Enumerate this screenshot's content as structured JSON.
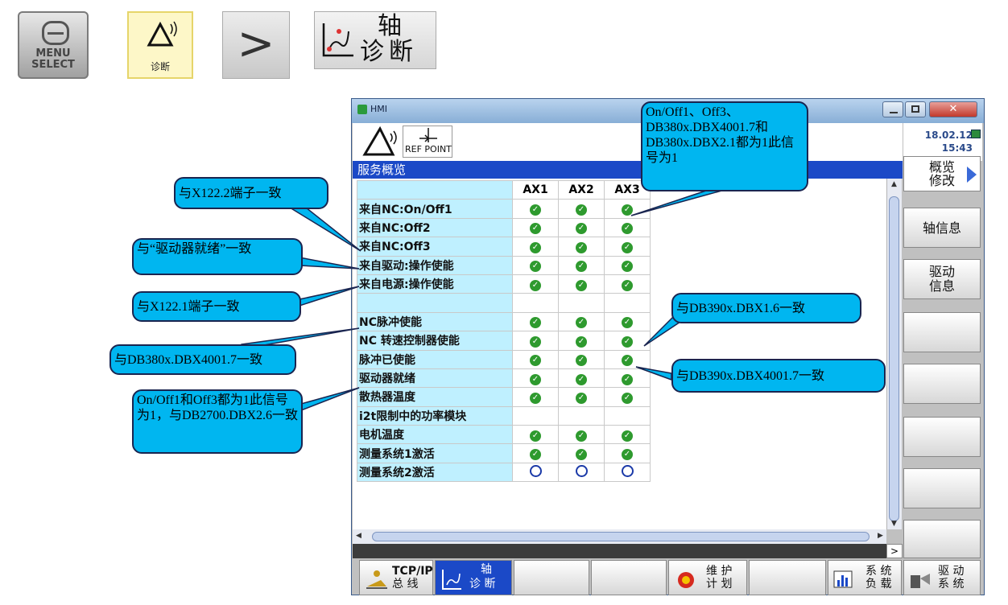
{
  "keys": {
    "menu_select_line1": "MENU",
    "menu_select_line2": "SELECT",
    "diagnosis_label": "诊断",
    "next_label": ">",
    "axis_diag_line1": "轴",
    "axis_diag_line2": "诊断"
  },
  "window": {
    "title": "HMI",
    "ref_point": "REF POINT",
    "date": "18.02.12",
    "time": "15:43",
    "panel_title": "服务概览"
  },
  "table": {
    "columns": [
      "AX1",
      "AX2",
      "AX3"
    ],
    "rows": [
      {
        "label": "来自NC:On/Off1",
        "status": [
          "ok",
          "ok",
          "ok"
        ]
      },
      {
        "label": "来自NC:Off2",
        "status": [
          "ok",
          "ok",
          "ok"
        ]
      },
      {
        "label": "来自NC:Off3",
        "status": [
          "ok",
          "ok",
          "ok"
        ]
      },
      {
        "label": "来自驱动:操作使能",
        "status": [
          "ok",
          "ok",
          "ok"
        ]
      },
      {
        "label": "来自电源:操作使能",
        "status": [
          "ok",
          "ok",
          "ok"
        ]
      },
      {
        "label": "",
        "status": [
          "",
          "",
          ""
        ]
      },
      {
        "label": "NC脉冲使能",
        "status": [
          "ok",
          "ok",
          "ok"
        ]
      },
      {
        "label": "NC 转速控制器使能",
        "status": [
          "ok",
          "ok",
          "ok"
        ]
      },
      {
        "label": "脉冲已使能",
        "status": [
          "ok",
          "ok",
          "ok"
        ]
      },
      {
        "label": "驱动器就绪",
        "status": [
          "ok",
          "ok",
          "ok"
        ]
      },
      {
        "label": "散热器温度",
        "status": [
          "ok",
          "ok",
          "ok"
        ]
      },
      {
        "label": "i2t限制中的功率模块",
        "status": [
          "",
          "",
          ""
        ]
      },
      {
        "label": "电机温度",
        "status": [
          "ok",
          "ok",
          "ok"
        ]
      },
      {
        "label": "测量系统1激活",
        "status": [
          "ok",
          "ok",
          "ok"
        ]
      },
      {
        "label": "测量系统2激活",
        "status": [
          "off",
          "off",
          "off"
        ]
      }
    ]
  },
  "vsoftkeys": {
    "overview_modify_1": "概览",
    "overview_modify_2": "修改",
    "axis_info": "轴信息",
    "drive_info_1": "驱动",
    "drive_info_2": "信息"
  },
  "hsoftkeys": {
    "tcpip_1": "TCP/IP",
    "tcpip_2": "总 线",
    "axis_1": "轴",
    "axis_2": "诊 断",
    "maint_1": "维 护",
    "maint_2": "计 划",
    "sys_1": "系 统",
    "sys_2": "负 载",
    "drv_1": "驱 动",
    "drv_2": "系 统"
  },
  "callouts": {
    "c1": "与X122.2端子一致",
    "c2": "与“驱动器就绪”一致",
    "c3": "与X122.1端子一致",
    "c4": "与DB380x.DBX4001.7一致",
    "c5": "On/Off1和Off3都为1此信号为1，与DB2700.DBX2.6一致",
    "c6": "On/Off1、Off3、DB380x.DBX4001.7和DB380x.DBX2.1都为1此信号为1",
    "c7": "与DB390x.DBX1.6一致",
    "c8": "与DB390x.DBX4001.7一致"
  },
  "colors": {
    "panel_blue": "#1b49c7",
    "label_cyan": "#bff0ff",
    "callout_cyan": "#00b6f0",
    "ok_green": "#2e9a2e"
  }
}
